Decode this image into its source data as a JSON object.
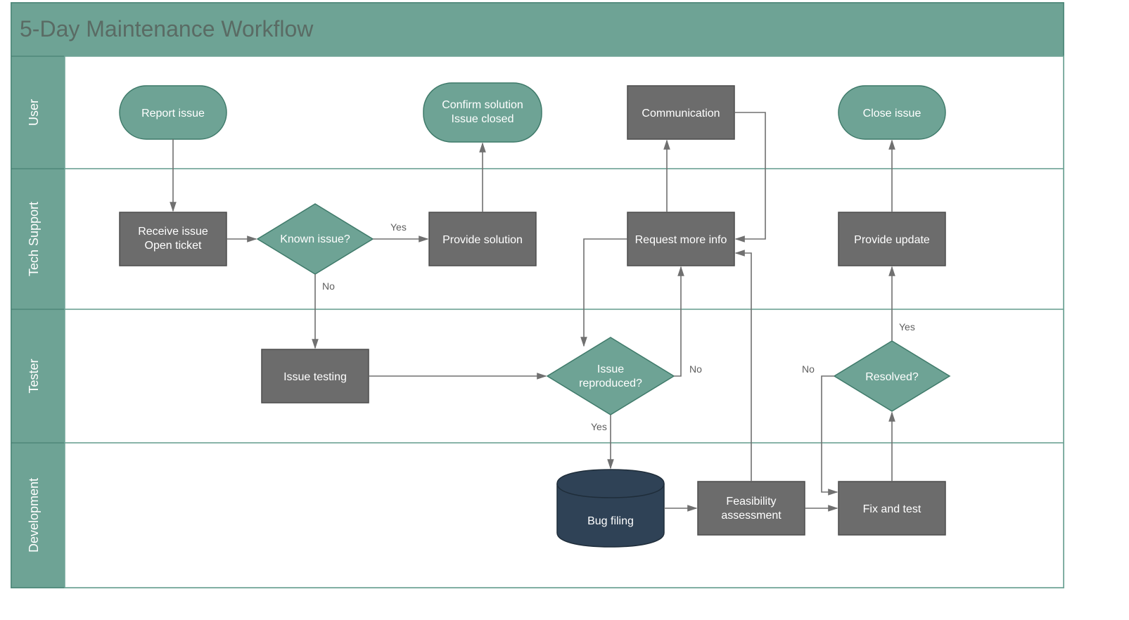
{
  "title": "5-Day Maintenance Workflow",
  "lanes": {
    "user": "User",
    "tech": "Tech Support",
    "tester": "Tester",
    "dev": "Development"
  },
  "nodes": {
    "report": "Report issue",
    "confirm1": "Confirm solution",
    "confirm2": "Issue closed",
    "communication": "Communication",
    "close": "Close issue",
    "receive1": "Receive issue",
    "receive2": "Open ticket",
    "known": "Known issue?",
    "provide": "Provide solution",
    "requestinfo": "Request more info",
    "update": "Provide update",
    "testing": "Issue testing",
    "reproduced1": "Issue",
    "reproduced2": "reproduced?",
    "resolved": "Resolved?",
    "bugfile": "Bug filing",
    "feasibility1": "Feasibility",
    "feasibility2": "assessment",
    "fixtest": "Fix and test"
  },
  "edgelabels": {
    "yes1": "Yes",
    "no1": "No",
    "no2": "No",
    "yes2": "Yes",
    "no3": "No",
    "yes3": "Yes"
  },
  "colors": {
    "teal": "#6ea395",
    "tealLight": "#7fb0a3",
    "tealBorder": "#3f7a6a",
    "gray": "#6c6c6c",
    "grayBorder": "#4d4d4d",
    "navy": "#2f4256",
    "navyBorder": "#1f2d3a",
    "laneHeader": "#6ea395",
    "laneBorder": "#3f7a6a"
  },
  "chart_data": {
    "type": "swimlane-flowchart",
    "title": "5-Day Maintenance Workflow",
    "lanes": [
      "User",
      "Tech Support",
      "Tester",
      "Development"
    ],
    "nodes": [
      {
        "id": "report",
        "lane": "User",
        "type": "terminator",
        "label": "Report issue"
      },
      {
        "id": "confirm",
        "lane": "User",
        "type": "terminator",
        "label": "Confirm solution / Issue closed"
      },
      {
        "id": "communication",
        "lane": "User",
        "type": "process",
        "label": "Communication"
      },
      {
        "id": "close",
        "lane": "User",
        "type": "terminator",
        "label": "Close issue"
      },
      {
        "id": "receive",
        "lane": "Tech Support",
        "type": "process",
        "label": "Receive issue / Open ticket"
      },
      {
        "id": "known",
        "lane": "Tech Support",
        "type": "decision",
        "label": "Known issue?"
      },
      {
        "id": "provide",
        "lane": "Tech Support",
        "type": "process",
        "label": "Provide solution"
      },
      {
        "id": "requestinfo",
        "lane": "Tech Support",
        "type": "process",
        "label": "Request more info"
      },
      {
        "id": "update",
        "lane": "Tech Support",
        "type": "process",
        "label": "Provide update"
      },
      {
        "id": "testing",
        "lane": "Tester",
        "type": "process",
        "label": "Issue testing"
      },
      {
        "id": "reproduced",
        "lane": "Tester",
        "type": "decision",
        "label": "Issue reproduced?"
      },
      {
        "id": "resolved",
        "lane": "Tester",
        "type": "decision",
        "label": "Resolved?"
      },
      {
        "id": "bugfile",
        "lane": "Development",
        "type": "datastore",
        "label": "Bug filing"
      },
      {
        "id": "feasibility",
        "lane": "Development",
        "type": "process",
        "label": "Feasibility assessment"
      },
      {
        "id": "fixtest",
        "lane": "Development",
        "type": "process",
        "label": "Fix and test"
      }
    ],
    "edges": [
      {
        "from": "report",
        "to": "receive"
      },
      {
        "from": "receive",
        "to": "known"
      },
      {
        "from": "known",
        "to": "provide",
        "label": "Yes"
      },
      {
        "from": "known",
        "to": "testing",
        "label": "No"
      },
      {
        "from": "provide",
        "to": "confirm"
      },
      {
        "from": "testing",
        "to": "reproduced"
      },
      {
        "from": "reproduced",
        "to": "requestinfo",
        "label": "No"
      },
      {
        "from": "reproduced",
        "to": "bugfile",
        "label": "Yes"
      },
      {
        "from": "requestinfo",
        "to": "communication"
      },
      {
        "from": "communication",
        "to": "requestinfo"
      },
      {
        "from": "requestinfo",
        "to": "reproduced"
      },
      {
        "from": "bugfile",
        "to": "feasibility"
      },
      {
        "from": "feasibility",
        "to": "fixtest"
      },
      {
        "from": "feasibility",
        "to": "requestinfo"
      },
      {
        "from": "fixtest",
        "to": "resolved"
      },
      {
        "from": "resolved",
        "to": "fixtest",
        "label": "No"
      },
      {
        "from": "resolved",
        "to": "update",
        "label": "Yes"
      },
      {
        "from": "update",
        "to": "close"
      }
    ]
  }
}
